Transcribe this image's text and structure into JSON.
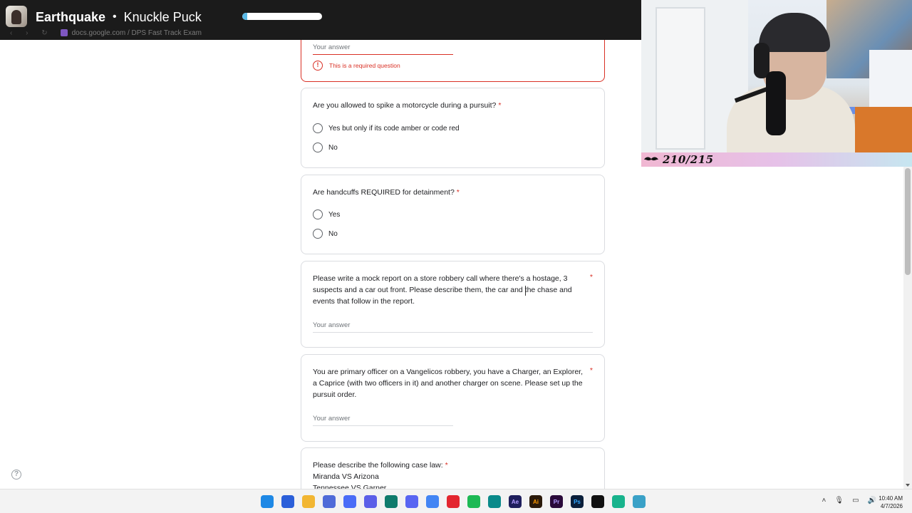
{
  "music": {
    "song": "Earthquake",
    "separator": "•",
    "artist": "Knuckle Puck",
    "progress": 0.06
  },
  "browser": {
    "url": "docs.google.com / DPS Fast Track Exam"
  },
  "overlay": {
    "counter": "210/215"
  },
  "form": {
    "prev_card": {
      "placeholder": "Your answer",
      "error": "This is a required question"
    },
    "q_motorcycle": {
      "title": "Are you allowed to spike a motorcycle during a pursuit?",
      "required": "*",
      "options": [
        "Yes but only if its code amber or code red",
        "No"
      ]
    },
    "q_handcuffs": {
      "title": "Are handcuffs REQUIRED for detainment?",
      "required": "*",
      "options": [
        "Yes",
        "No"
      ]
    },
    "q_report": {
      "title": "Please write a mock report on a store robbery call where there's a hostage, 3 suspects and a car out front. Please describe them, the car and the chase and events that follow in the report.",
      "required": "*",
      "placeholder": "Your answer"
    },
    "q_pursuit": {
      "title": "You are primary officer on a Vangelicos robbery, you have a Charger, an Explorer, a Caprice (with two officers in it) and another charger on scene. Please set up the pursuit order.",
      "required": "*",
      "placeholder": "Your answer"
    },
    "q_caselaw": {
      "title": "Please describe the following case law:",
      "required": "*",
      "line1": "Miranda VS Arizona",
      "line2": "Tennessee VS Garner"
    }
  },
  "taskbar": {
    "icons": [
      "windows-start",
      "store",
      "file-explorer",
      "app-1",
      "app-2",
      "app-3",
      "app-4",
      "discord",
      "chrome",
      "app-5",
      "spotify",
      "app-6",
      "after-effects",
      "illustrator",
      "premiere",
      "photoshop",
      "capcut",
      "audio-app",
      "browser-2"
    ],
    "icon_labels": [
      "",
      "",
      "",
      "",
      "",
      "",
      "",
      "",
      "",
      "",
      "",
      "",
      "Ae",
      "Ai",
      "Pr",
      "Ps",
      "",
      "",
      ""
    ],
    "time": "10:40 AM",
    "date": "4/7/2026"
  }
}
